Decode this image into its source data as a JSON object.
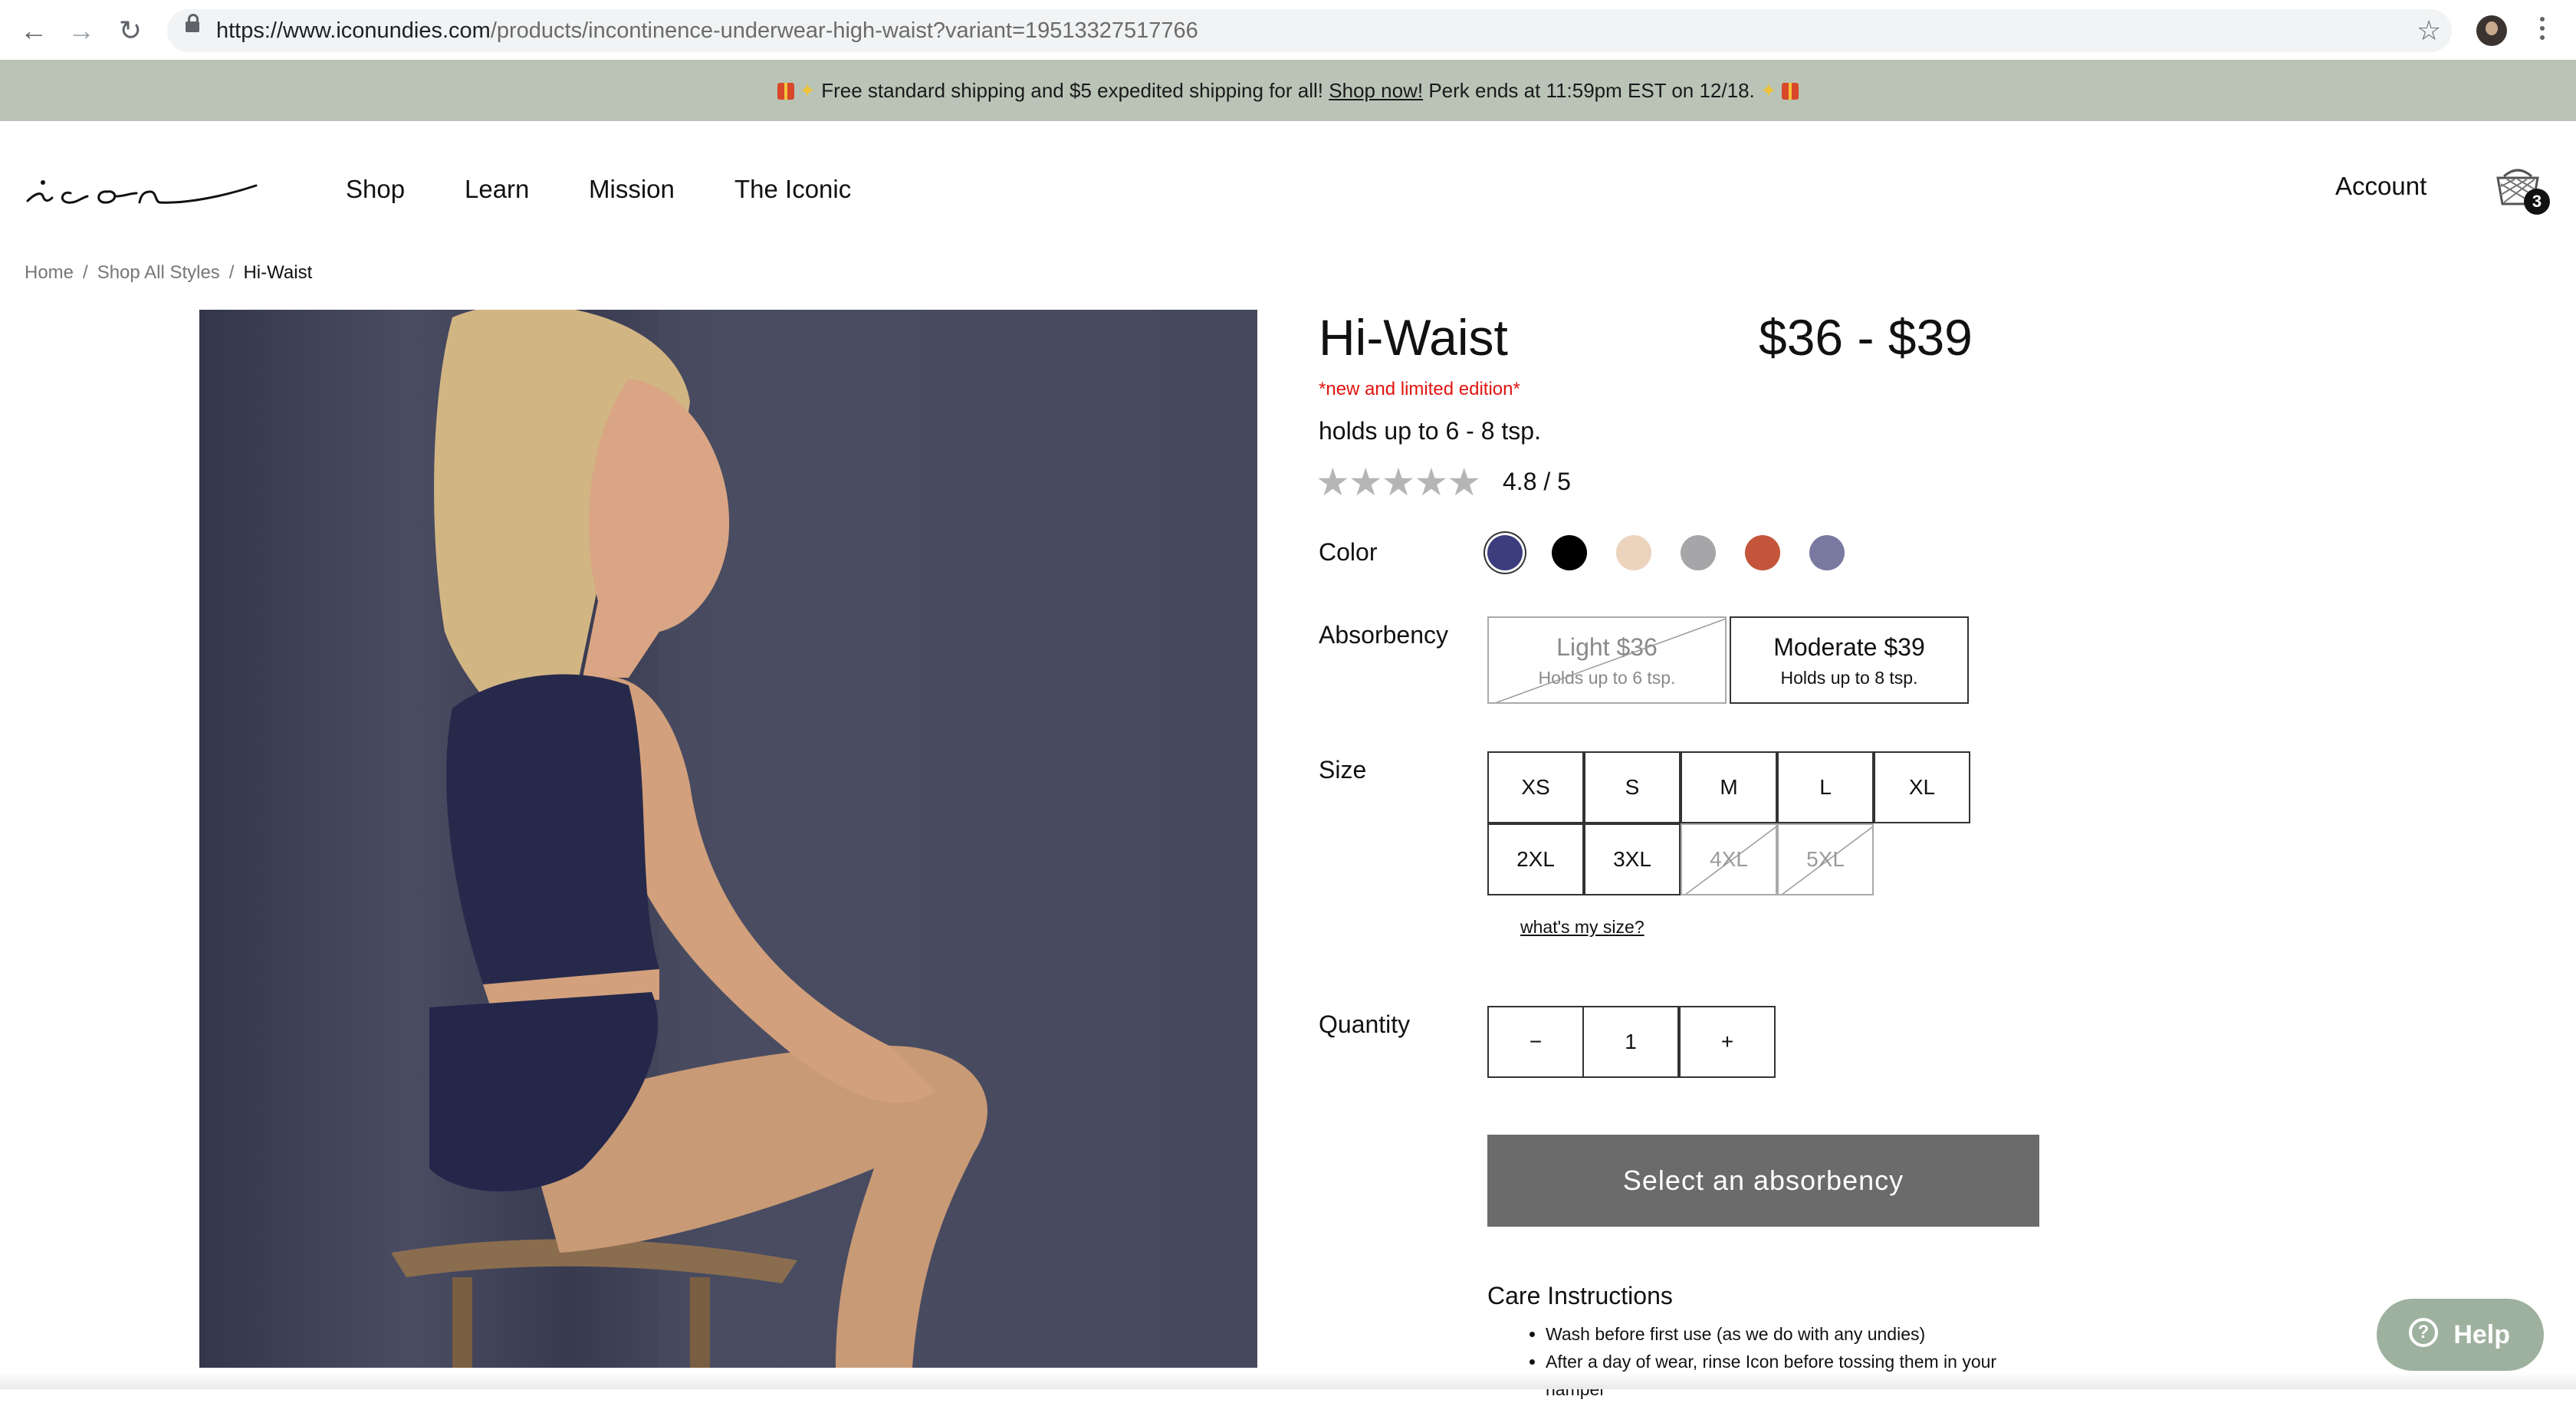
{
  "browser": {
    "url_domain": "https://www.iconundies.com",
    "url_path": "/products/incontinence-underwear-high-waist?variant=19513327517766",
    "back_icon": "←",
    "forward_icon": "→",
    "reload_icon": "↻",
    "star_icon": "☆"
  },
  "banner": {
    "text_before": "Free standard shipping and $5 expedited shipping for all!",
    "link": "Shop now!",
    "text_after": "Perk ends at 11:59pm EST on 12/18."
  },
  "header": {
    "nav": [
      "Shop",
      "Learn",
      "Mission",
      "The Iconic"
    ],
    "account": "Account",
    "cart_count": "3"
  },
  "breadcrumb": {
    "items": [
      "Home",
      "Shop All Styles"
    ],
    "current": "Hi-Waist",
    "separator": "/"
  },
  "product": {
    "title": "Hi-Waist",
    "price": "$36 - $39",
    "edition_note": "*new and limited edition*",
    "capacity": "holds up to 6 - 8 tsp.",
    "stars": "★★★★★",
    "rating": "4.8 / 5",
    "rating_value": 4.8
  },
  "color": {
    "label": "Color",
    "swatches": [
      "#3d3d7d",
      "#000000",
      "#ecd3bd",
      "#a6a6a8",
      "#c4553a",
      "#7979a1"
    ],
    "selected_index": 0
  },
  "absorbency": {
    "label": "Absorbency",
    "options": [
      {
        "title": "Light $36",
        "sub": "Holds up to 6 tsp.",
        "available": false
      },
      {
        "title": "Moderate $39",
        "sub": "Holds up to 8 tsp.",
        "available": true
      }
    ]
  },
  "size": {
    "label": "Size",
    "options": [
      "XS",
      "S",
      "M",
      "L",
      "XL",
      "2XL",
      "3XL",
      "4XL",
      "5XL"
    ],
    "unavailable": [
      "4XL",
      "5XL"
    ],
    "guide_link": "what's my size?"
  },
  "quantity": {
    "label": "Quantity",
    "minus": "−",
    "value": "1",
    "plus": "+"
  },
  "cta": "Select an absorbency",
  "care": {
    "title": "Care Instructions",
    "items": [
      "Wash before first use (as we do with any undies)",
      "After a day of wear, rinse Icon before tossing them in your hamper"
    ]
  },
  "help": {
    "label": "Help",
    "icon": "?"
  }
}
